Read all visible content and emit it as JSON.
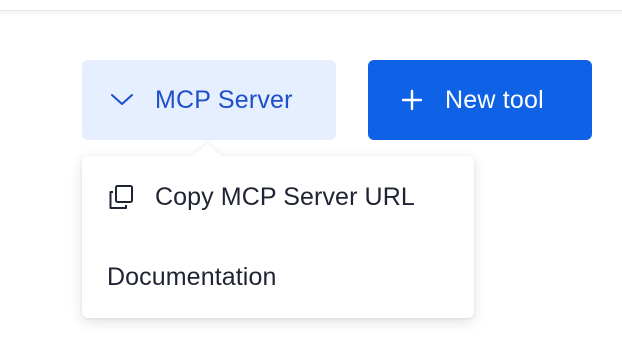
{
  "toolbar": {
    "mcp_server_label": "MCP Server",
    "mcp_icon": "chevron-down-icon",
    "new_tool_label": "New tool",
    "new_tool_icon": "plus-icon"
  },
  "dropdown": {
    "items": [
      {
        "label": "Copy MCP Server URL",
        "icon": "copy-icon"
      },
      {
        "label": "Documentation"
      }
    ]
  },
  "colors": {
    "primary": "#0f62e6",
    "secondary_bg": "#e6efff",
    "secondary_text": "#1d4fc9",
    "menu_text": "#1f2433"
  }
}
